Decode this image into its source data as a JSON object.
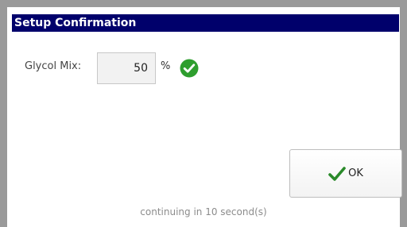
{
  "dialog": {
    "title": "Setup Confirmation"
  },
  "field": {
    "label": "Glycol Mix:",
    "value": "50",
    "unit": "%",
    "status_icon": "check-circle-icon"
  },
  "buttons": {
    "ok_label": "OK",
    "ok_icon": "checkmark-icon"
  },
  "status_text": "continuing in 10 second(s)",
  "colors": {
    "title_bar": "#00006b",
    "success_green": "#2e9e2e"
  }
}
